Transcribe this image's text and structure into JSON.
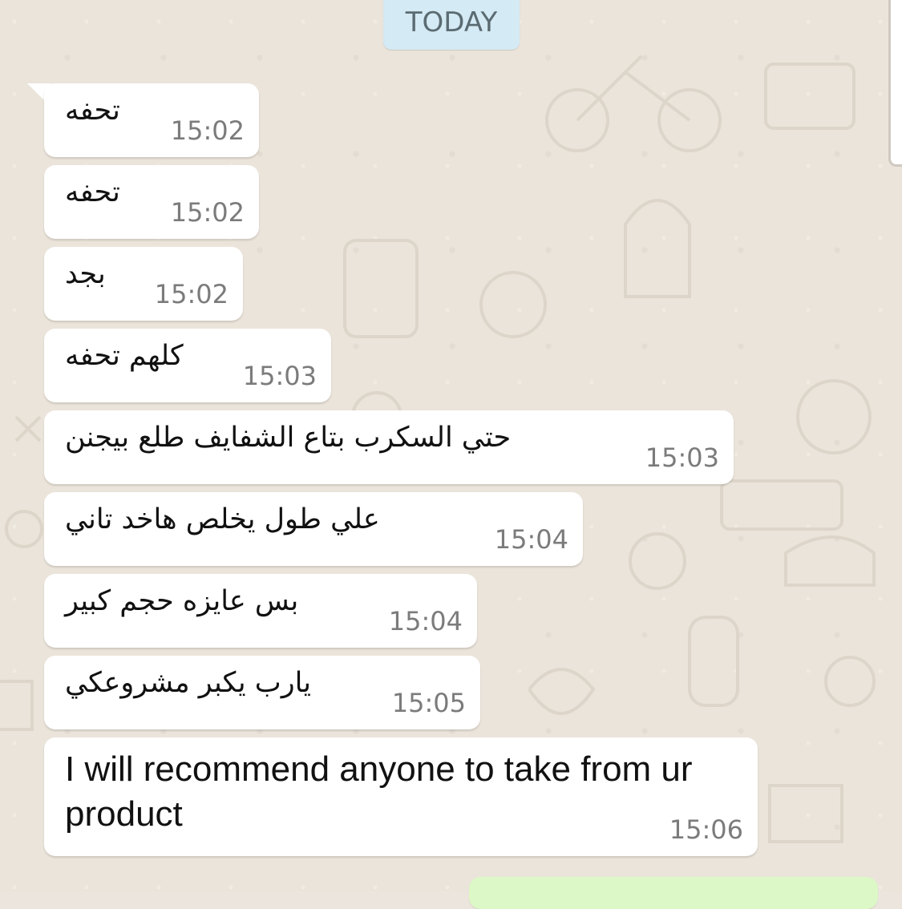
{
  "date_label": "TODAY",
  "messages": [
    {
      "text": "تحفه",
      "time": "15:02"
    },
    {
      "text": "تحفه",
      "time": "15:02"
    },
    {
      "text": "بجد",
      "time": "15:02"
    },
    {
      "text": "كلهم تحفه",
      "time": "15:03"
    },
    {
      "text": "حتي السكرب بتاع الشفايف طلع بيجنن",
      "time": "15:03"
    },
    {
      "text": "علي طول يخلص هاخد تاني",
      "time": "15:04"
    },
    {
      "text": "بس عايزه حجم كبير",
      "time": "15:04"
    },
    {
      "text": "يارب يكبر مشروعكي",
      "time": "15:05"
    },
    {
      "text": "I will recommend anyone to take from ur product",
      "time": "15:06"
    }
  ],
  "colors": {
    "chat_background": "#ebe4da",
    "incoming_bubble": "#ffffff",
    "outgoing_bubble": "#dcf8c6",
    "date_pill": "#d4eaf4",
    "timestamp": "#7b7b7b"
  }
}
